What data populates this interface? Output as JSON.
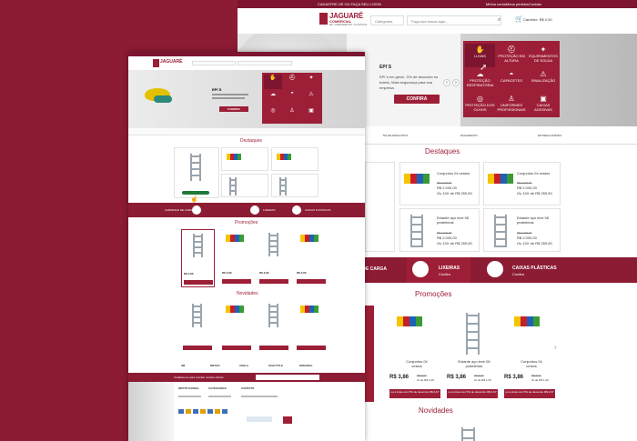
{
  "back": {
    "topbar": {
      "center": "CADASTRE-SE OU FAÇA SEU LOGIN",
      "links": [
        "Minha conta",
        "Meus pedidos",
        "Contato"
      ]
    },
    "logo": {
      "name": "JAGUARÉ",
      "sub": "COMERCIAL",
      "tag": "EPI  •  FERRAMENTAS  •  PLÁSTICOS"
    },
    "search": {
      "category": "Categorias",
      "placeholder": "Faça sua busca aqui..."
    },
    "cart": {
      "label": "Carrinho: R$ 0,00"
    },
    "hero": {
      "title": "EPI´S",
      "text": "EPI´s em geral - 5% de desconto no boleto. Mais segurança para sua empresa.",
      "cta": "CONFIRA"
    },
    "menu_tiles": [
      "LUVAS",
      "PROTEÇÃO EM ALTURA",
      "EQUIPAMENTOS DE SOLDA",
      "PROTEÇÃO RESPIRATÓRIA",
      "CAPACETES",
      "SINALIZAÇÃO",
      "PROTEÇÃO DOS OLHOS",
      "UNIFORMES PROFISSIONAIS",
      "CAIXAS ADESIVAS"
    ],
    "features": [
      "5% DE DESCONTO",
      "PAGAMENTO",
      "ENTREGA RÁPIDA"
    ],
    "destaques": {
      "title": "Destaques",
      "items": [
        {
          "name": "Conjuntos 04 cestos",
          "old": "R$ 0.000,00",
          "price": "R$ 2.000,00",
          "inst": "Ou 10X de R$ 259,50"
        },
        {
          "name": "Conjuntos 04 cestos",
          "old": "R$ 0.000,00",
          "price": "R$ 2.000,00",
          "inst": "Ou 10X de R$ 259,50"
        },
        {
          "name": "Estante aço leve 06 prateleiras",
          "old": "R$ 0.000,00",
          "price": "R$ 2.000,00",
          "inst": "Ou 10X de R$ 259,50"
        },
        {
          "name": "Estante aço leve 06 prateleiras",
          "old": "R$ 0.000,00",
          "price": "R$ 2.000,00",
          "inst": "Ou 10X de R$ 259,50"
        }
      ]
    },
    "banner": {
      "left": "O DE CARGA",
      "mid_title": "LIXEIRAS",
      "mid_sub": "Confira",
      "right_title": "CAIXAS PLÁSTICAS",
      "right_sub": "Confira"
    },
    "promocoes": {
      "title": "Promoções",
      "items": [
        {
          "name": "Conjuntos 04 cestos",
          "price": "R$ 3,86",
          "old": "R$ 5,90",
          "inst": "3x de R$ 1,29",
          "cta": "ou à vista com 5% de desconto R$ 3,67"
        },
        {
          "name": "Estante aço leve 06 prateleiras",
          "price": "R$ 3,86",
          "old": "R$ 5,90",
          "inst": "3x de R$ 1,29",
          "cta": "ou à vista com 5% de desconto R$ 3,67"
        },
        {
          "name": "Conjuntos 04 cestos",
          "price": "R$ 3,86",
          "old": "R$ 5,90",
          "inst": "3x de R$ 1,29",
          "cta": "ou à vista com 5% de desconto R$ 3,67"
        }
      ]
    },
    "novidades": {
      "title": "Novidades"
    }
  },
  "front": {
    "hero": {
      "title": "EPI´S",
      "cta": "CONFIRA"
    },
    "destaques_title": "Destaques",
    "banner": {
      "left": "CARRINHO DE CARGA",
      "mid": "LIXEIRAS",
      "right": "CAIXAS PLÁSTICAS"
    },
    "promocoes_title": "Promoções",
    "novidades_title": "Novidades",
    "prod_price": "R$ 3,86",
    "brands": [
      "3M",
      "BRAVO",
      "VIGILA",
      "SCHÜTTLE",
      "ORIGINAL"
    ],
    "newsletter": "Cadastre-se para receber nossas ofertas",
    "footer_cols": [
      "INSTITUCIONAL",
      "CATEGORIAS",
      "CONTATO"
    ]
  }
}
